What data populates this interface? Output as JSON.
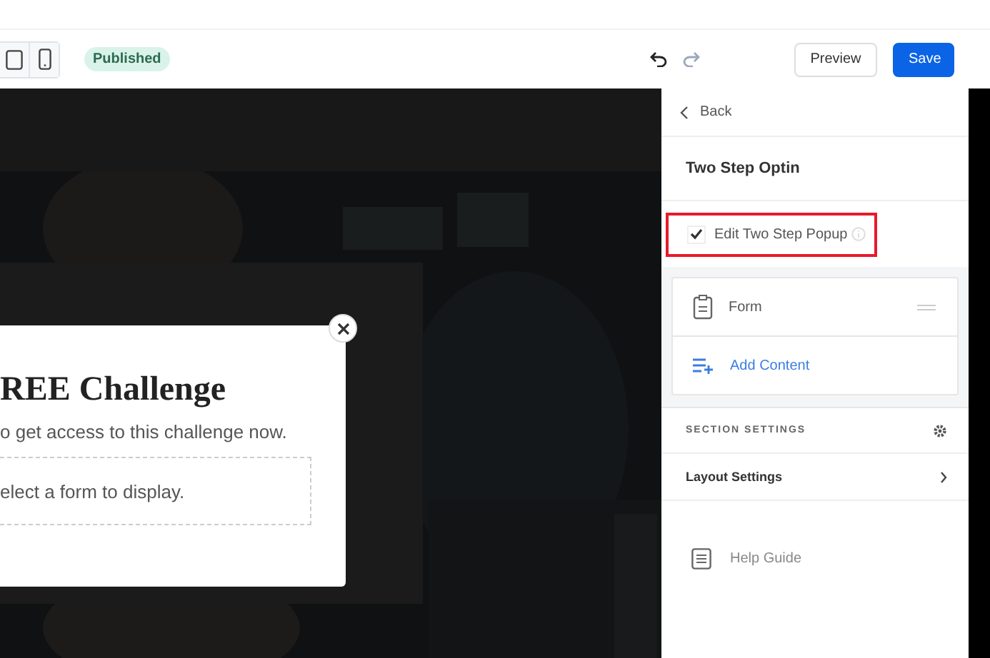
{
  "toolbar": {
    "devices": [
      {
        "kind": "tablet",
        "selected": false
      },
      {
        "kind": "mobile",
        "selected": false
      }
    ],
    "status": "Published",
    "undo_enabled": true,
    "redo_enabled": false,
    "buttons": [
      {
        "label": "Preview",
        "kind": "secondary"
      },
      {
        "label": "Save",
        "kind": "primary"
      }
    ]
  },
  "canvas": {
    "popup": {
      "title": "REE Challenge",
      "subtitle": "o get access to this challenge now.",
      "form_placeholder": "elect a form to display."
    }
  },
  "panel": {
    "back": "Back",
    "title": "Two Step Optin",
    "edit_toggle": {
      "label": "Edit Two Step Popup",
      "checked": true
    },
    "elements": [
      {
        "kind": "form",
        "label": "Form"
      },
      {
        "kind": "add",
        "label": "Add Content"
      }
    ],
    "section_heading": "SECTION SETTINGS",
    "layout_settings": "Layout Settings",
    "help": "Help Guide"
  }
}
